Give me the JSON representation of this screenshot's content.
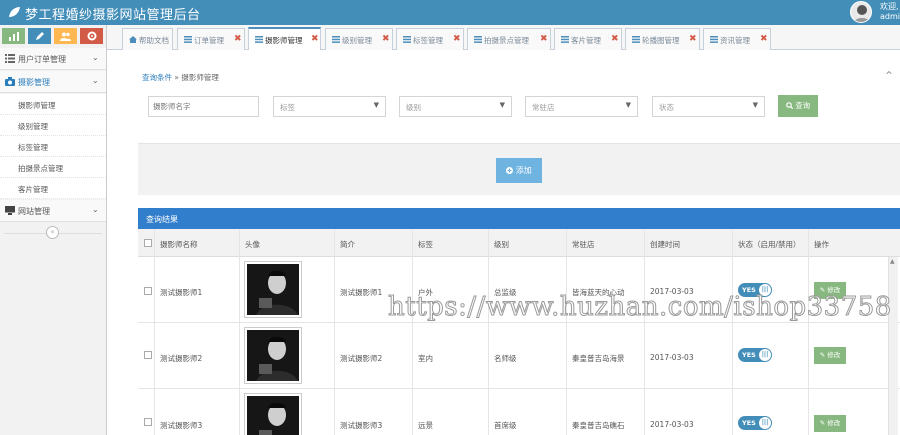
{
  "header": {
    "app_title": "梦工程婚纱摄影网站管理后台",
    "welcome": "欢迎,",
    "username": "admi"
  },
  "sidebar": {
    "shortcuts": [
      {
        "icon": "bar-chart-icon",
        "color": "#87b87f"
      },
      {
        "icon": "pencil-icon",
        "color": "#438eb9"
      },
      {
        "icon": "users-icon",
        "color": "#ffb752"
      },
      {
        "icon": "cogs-icon",
        "color": "#d15b47"
      }
    ],
    "menu": [
      {
        "label": "用户订单管理",
        "icon": "list-icon"
      },
      {
        "label": "摄影管理",
        "icon": "camera-icon"
      },
      {
        "label": "网站管理",
        "icon": "desktop-icon"
      }
    ],
    "submenu": [
      "摄影师管理",
      "级别管理",
      "标签管理",
      "拍摄景点管理",
      "客片管理"
    ]
  },
  "tabs": [
    {
      "label": "帮助文档",
      "icon": "home-icon",
      "closable": false
    },
    {
      "label": "订单管理",
      "icon": "list-icon",
      "closable": true
    },
    {
      "label": "摄影师管理",
      "icon": "list-icon",
      "closable": true
    },
    {
      "label": "级别管理",
      "icon": "list-icon",
      "closable": true
    },
    {
      "label": "标签管理",
      "icon": "list-icon",
      "closable": true
    },
    {
      "label": "拍摄景点管理",
      "icon": "list-icon",
      "closable": true
    },
    {
      "label": "客片管理",
      "icon": "list-icon",
      "closable": true
    },
    {
      "label": "轮播图管理",
      "icon": "list-icon",
      "closable": true
    },
    {
      "label": "资讯管理",
      "icon": "list-icon",
      "closable": true
    }
  ],
  "query": {
    "crumb_root": "查询条件",
    "crumb_sep": "»",
    "crumb_current": "摄影师管理",
    "name_placeholder": "摄影师名字",
    "tag_select": "标签",
    "level_select": "级别",
    "spot_select": "常驻店",
    "status_select": "状态",
    "search_label": "查询",
    "add_label": "添加"
  },
  "results": {
    "title": "查询结果",
    "columns": [
      "摄影师名称",
      "头像",
      "简介",
      "标签",
      "级别",
      "常驻店",
      "创建时间",
      "状态（启用/禁用）",
      "操作"
    ],
    "rows": [
      {
        "name": "测试摄影师1",
        "intro": "测试摄影师1",
        "tag": "户外",
        "level": "总监级",
        "store": "皆海蓝天的心动",
        "created": "2017-03-03",
        "status": "YES",
        "action": "修改"
      },
      {
        "name": "测试摄影师2",
        "intro": "测试摄影师2",
        "tag": "室内",
        "level": "名师级",
        "store": "秦皇普吉岛海景",
        "created": "2017-03-03",
        "status": "YES",
        "action": "修改"
      },
      {
        "name": "测试摄影师3",
        "intro": "测试摄影师3",
        "tag": "远景",
        "level": "首席级",
        "store": "秦皇普吉岛礁石",
        "created": "2017-03-03",
        "status": "YES",
        "action": "修改"
      }
    ]
  },
  "watermark": "https://www.huzhan.com/ishop33758",
  "colors": {
    "brand": "#438eb9",
    "success": "#87b87f",
    "info": "#6fb3e0",
    "danger": "#d15b47"
  }
}
